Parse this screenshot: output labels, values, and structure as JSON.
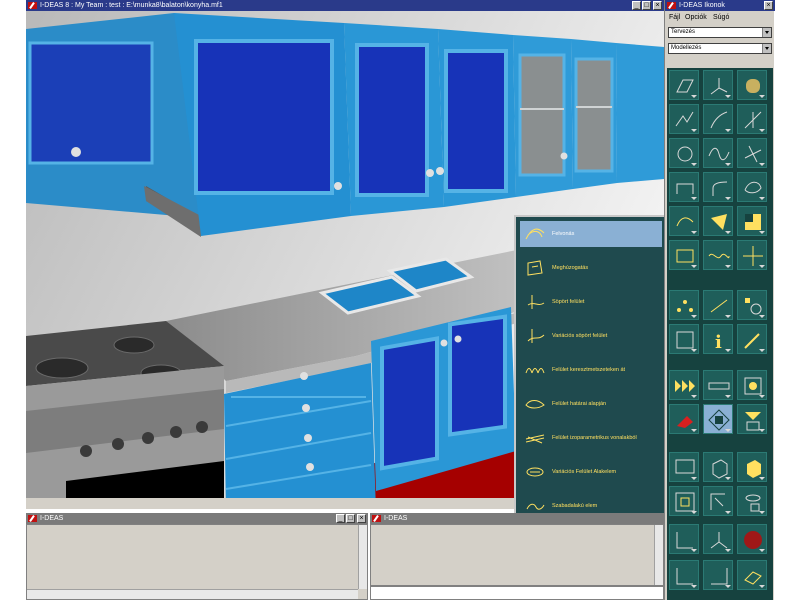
{
  "main_window": {
    "title": "I-DEAS 8 :    My Team : test : E:\\munka8\\balaton\\konyha.mf1"
  },
  "icons_panel": {
    "title": "I-DEAS Ikonok",
    "menu": [
      "Fájl",
      "Opciók",
      "Súgó"
    ],
    "task_select": "Tervezés",
    "mode_select": "Modellezés"
  },
  "flyout": {
    "items": [
      {
        "label": "Felvonás",
        "icon": "loft-icon",
        "selected": true
      },
      {
        "label": "Meghúzogatás",
        "icon": "sweep-surface-icon"
      },
      {
        "label": "Söpört felület",
        "icon": "swept-surface-icon"
      },
      {
        "label": "Variációs söpört felület",
        "icon": "variational-sweep-icon"
      },
      {
        "label": "Felület keresztmetszeteken át",
        "icon": "surface-through-sections-icon"
      },
      {
        "label": "Felület határai alapján",
        "icon": "boundary-surface-icon"
      },
      {
        "label": "Felület izoparametrikus vonalakból",
        "icon": "isoparametric-surface-icon"
      },
      {
        "label": "Variációs Felület Alakelem",
        "icon": "variational-surface-feature-icon"
      },
      {
        "label": "Szabadalakú elem",
        "icon": "freeform-feature-icon"
      }
    ]
  },
  "prompt_window": {
    "title": "I-DEAS"
  },
  "list_window": {
    "title": "I-DEAS"
  },
  "colors": {
    "titlebar_active": "#2a3a8a",
    "titlebar_inactive": "#7b7b7b",
    "cabinet_blue": "#1e86c8",
    "panel_teal": "#1f5e5a",
    "flyout_bg": "#1f4a4e",
    "floor_red": "#a50000"
  }
}
